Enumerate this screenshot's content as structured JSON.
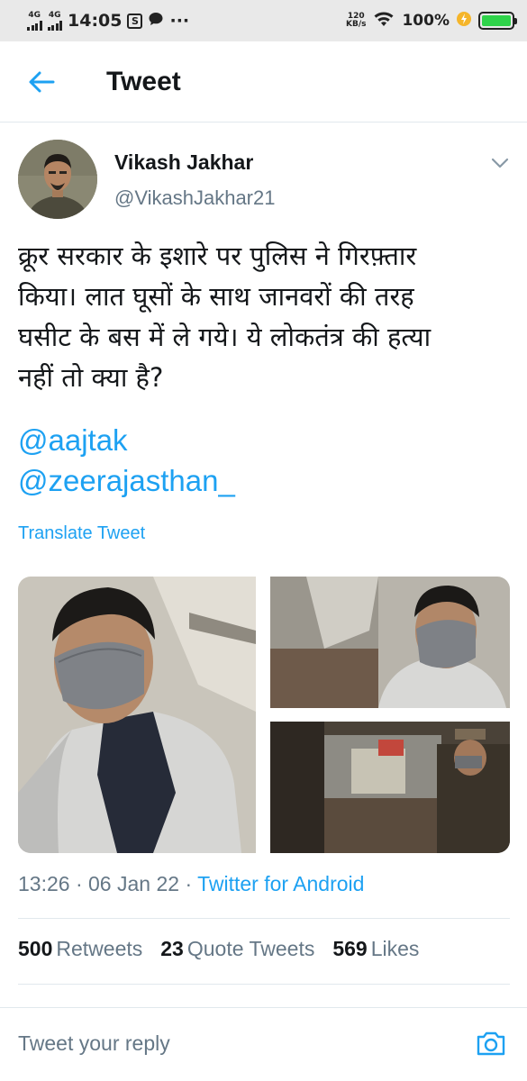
{
  "status_bar": {
    "network1": "4G",
    "network2": "4G",
    "time": "14:05",
    "notif_s": "S",
    "dots": "···",
    "speed_value": "120",
    "speed_unit": "KB/s",
    "battery_percent": "100%",
    "battery_level": 1.0
  },
  "app_bar": {
    "title": "Tweet",
    "back_icon": "arrow-left-icon"
  },
  "tweet": {
    "author_name": "Vikash Jakhar",
    "author_handle": "@VikashJakhar21",
    "text_lines": [
      "क्रूर सरकार के इशारे पर पुलिस ने गिरफ़्तार",
      "किया। लात घूसों के साथ जानवरों की तरह",
      "घसीट के बस में ले गये। ये लोकतंत्र की हत्या",
      "नहीं तो क्या है?"
    ],
    "mentions": [
      "@aajtak",
      "@zeerajasthan_"
    ],
    "translate_label": "Translate Tweet",
    "time": "13:26",
    "sep": "·",
    "date": "06 Jan 22",
    "source": "Twitter for Android"
  },
  "stats": {
    "retweets_count": "500",
    "retweets_label": "Retweets",
    "quotes_count": "23",
    "quotes_label": "Quote Tweets",
    "likes_count": "569",
    "likes_label": "Likes"
  },
  "reply": {
    "placeholder": "Tweet your reply",
    "camera_icon": "camera-icon"
  },
  "colors": {
    "accent": "#1da1f2",
    "text_primary": "#14171a",
    "text_secondary": "#657786",
    "divider": "#e1e8ed",
    "status_bar_bg": "#e9e9e9",
    "battery_fill": "#2fd34a"
  }
}
